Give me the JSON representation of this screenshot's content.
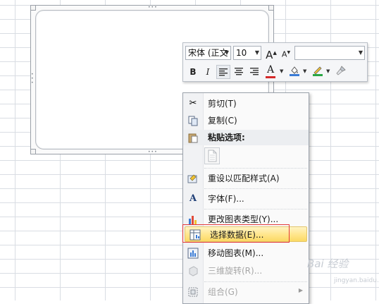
{
  "mini_toolbar": {
    "font_name": "宋体 (正文",
    "font_size": "10",
    "grow_label": "A",
    "shrink_label": "A",
    "style_value": "",
    "bold_label": "B",
    "italic_label": "I",
    "font_color_label": "A",
    "font_color": "#d42a2a",
    "fill_color": "#3a7bd5",
    "line_color": "#2aa745"
  },
  "context_menu": {
    "items": [
      {
        "label": "剪切(T)",
        "icon": "scissors-icon",
        "enabled": true
      },
      {
        "label": "复制(C)",
        "icon": "copy-icon",
        "enabled": true
      },
      {
        "label": "粘贴选项:",
        "icon": "paste-icon",
        "enabled": true,
        "header": true
      },
      {
        "label": "重设以匹配样式(A)",
        "icon": "reset-style-icon",
        "enabled": true
      },
      {
        "label": "字体(F)...",
        "icon": "font-icon",
        "enabled": true
      },
      {
        "label": "更改图表类型(Y)...",
        "icon": "chart-type-icon",
        "enabled": true
      },
      {
        "label": "选择数据(E)...",
        "icon": "select-data-icon",
        "enabled": true,
        "highlighted": true
      },
      {
        "label": "移动图表(M)...",
        "icon": "move-chart-icon",
        "enabled": true
      },
      {
        "label": "三维旋转(R)...",
        "icon": "3d-rotate-icon",
        "enabled": false
      },
      {
        "label": "组合(G)",
        "icon": "group-icon",
        "enabled": false,
        "submenu": true
      }
    ]
  },
  "watermark": {
    "text": "Bai 经验",
    "sub": "jingyan.baidu.com"
  }
}
